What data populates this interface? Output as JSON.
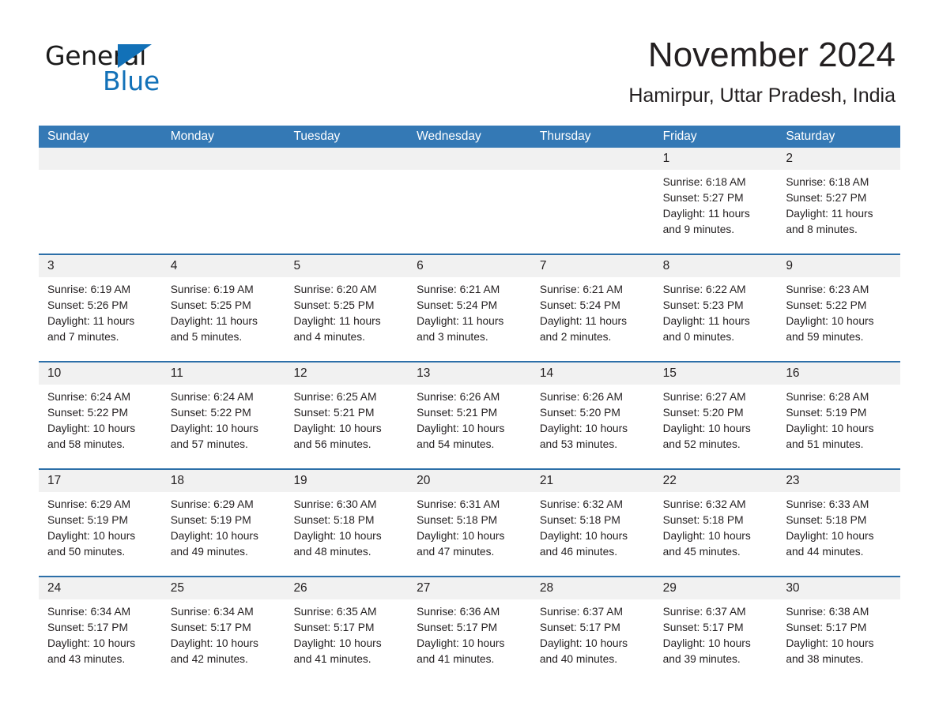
{
  "brand": {
    "name_part1": "General",
    "name_part2": "Blue",
    "triangle_icon": "triangle-icon",
    "accent_color": "#1271b8"
  },
  "header": {
    "month_title": "November 2024",
    "location": "Hamirpur, Uttar Pradesh, India"
  },
  "calendar": {
    "header_bg": "#3479b5",
    "day_band_bg": "#f1f1f1",
    "row_border": "#2c6fa8",
    "weekdays": [
      "Sunday",
      "Monday",
      "Tuesday",
      "Wednesday",
      "Thursday",
      "Friday",
      "Saturday"
    ],
    "weeks": [
      [
        {
          "date": "",
          "lines": []
        },
        {
          "date": "",
          "lines": []
        },
        {
          "date": "",
          "lines": []
        },
        {
          "date": "",
          "lines": []
        },
        {
          "date": "",
          "lines": []
        },
        {
          "date": "1",
          "lines": [
            "Sunrise: 6:18 AM",
            "Sunset: 5:27 PM",
            "Daylight: 11 hours",
            "and 9 minutes."
          ]
        },
        {
          "date": "2",
          "lines": [
            "Sunrise: 6:18 AM",
            "Sunset: 5:27 PM",
            "Daylight: 11 hours",
            "and 8 minutes."
          ]
        }
      ],
      [
        {
          "date": "3",
          "lines": [
            "Sunrise: 6:19 AM",
            "Sunset: 5:26 PM",
            "Daylight: 11 hours",
            "and 7 minutes."
          ]
        },
        {
          "date": "4",
          "lines": [
            "Sunrise: 6:19 AM",
            "Sunset: 5:25 PM",
            "Daylight: 11 hours",
            "and 5 minutes."
          ]
        },
        {
          "date": "5",
          "lines": [
            "Sunrise: 6:20 AM",
            "Sunset: 5:25 PM",
            "Daylight: 11 hours",
            "and 4 minutes."
          ]
        },
        {
          "date": "6",
          "lines": [
            "Sunrise: 6:21 AM",
            "Sunset: 5:24 PM",
            "Daylight: 11 hours",
            "and 3 minutes."
          ]
        },
        {
          "date": "7",
          "lines": [
            "Sunrise: 6:21 AM",
            "Sunset: 5:24 PM",
            "Daylight: 11 hours",
            "and 2 minutes."
          ]
        },
        {
          "date": "8",
          "lines": [
            "Sunrise: 6:22 AM",
            "Sunset: 5:23 PM",
            "Daylight: 11 hours",
            "and 0 minutes."
          ]
        },
        {
          "date": "9",
          "lines": [
            "Sunrise: 6:23 AM",
            "Sunset: 5:22 PM",
            "Daylight: 10 hours",
            "and 59 minutes."
          ]
        }
      ],
      [
        {
          "date": "10",
          "lines": [
            "Sunrise: 6:24 AM",
            "Sunset: 5:22 PM",
            "Daylight: 10 hours",
            "and 58 minutes."
          ]
        },
        {
          "date": "11",
          "lines": [
            "Sunrise: 6:24 AM",
            "Sunset: 5:22 PM",
            "Daylight: 10 hours",
            "and 57 minutes."
          ]
        },
        {
          "date": "12",
          "lines": [
            "Sunrise: 6:25 AM",
            "Sunset: 5:21 PM",
            "Daylight: 10 hours",
            "and 56 minutes."
          ]
        },
        {
          "date": "13",
          "lines": [
            "Sunrise: 6:26 AM",
            "Sunset: 5:21 PM",
            "Daylight: 10 hours",
            "and 54 minutes."
          ]
        },
        {
          "date": "14",
          "lines": [
            "Sunrise: 6:26 AM",
            "Sunset: 5:20 PM",
            "Daylight: 10 hours",
            "and 53 minutes."
          ]
        },
        {
          "date": "15",
          "lines": [
            "Sunrise: 6:27 AM",
            "Sunset: 5:20 PM",
            "Daylight: 10 hours",
            "and 52 minutes."
          ]
        },
        {
          "date": "16",
          "lines": [
            "Sunrise: 6:28 AM",
            "Sunset: 5:19 PM",
            "Daylight: 10 hours",
            "and 51 minutes."
          ]
        }
      ],
      [
        {
          "date": "17",
          "lines": [
            "Sunrise: 6:29 AM",
            "Sunset: 5:19 PM",
            "Daylight: 10 hours",
            "and 50 minutes."
          ]
        },
        {
          "date": "18",
          "lines": [
            "Sunrise: 6:29 AM",
            "Sunset: 5:19 PM",
            "Daylight: 10 hours",
            "and 49 minutes."
          ]
        },
        {
          "date": "19",
          "lines": [
            "Sunrise: 6:30 AM",
            "Sunset: 5:18 PM",
            "Daylight: 10 hours",
            "and 48 minutes."
          ]
        },
        {
          "date": "20",
          "lines": [
            "Sunrise: 6:31 AM",
            "Sunset: 5:18 PM",
            "Daylight: 10 hours",
            "and 47 minutes."
          ]
        },
        {
          "date": "21",
          "lines": [
            "Sunrise: 6:32 AM",
            "Sunset: 5:18 PM",
            "Daylight: 10 hours",
            "and 46 minutes."
          ]
        },
        {
          "date": "22",
          "lines": [
            "Sunrise: 6:32 AM",
            "Sunset: 5:18 PM",
            "Daylight: 10 hours",
            "and 45 minutes."
          ]
        },
        {
          "date": "23",
          "lines": [
            "Sunrise: 6:33 AM",
            "Sunset: 5:18 PM",
            "Daylight: 10 hours",
            "and 44 minutes."
          ]
        }
      ],
      [
        {
          "date": "24",
          "lines": [
            "Sunrise: 6:34 AM",
            "Sunset: 5:17 PM",
            "Daylight: 10 hours",
            "and 43 minutes."
          ]
        },
        {
          "date": "25",
          "lines": [
            "Sunrise: 6:34 AM",
            "Sunset: 5:17 PM",
            "Daylight: 10 hours",
            "and 42 minutes."
          ]
        },
        {
          "date": "26",
          "lines": [
            "Sunrise: 6:35 AM",
            "Sunset: 5:17 PM",
            "Daylight: 10 hours",
            "and 41 minutes."
          ]
        },
        {
          "date": "27",
          "lines": [
            "Sunrise: 6:36 AM",
            "Sunset: 5:17 PM",
            "Daylight: 10 hours",
            "and 41 minutes."
          ]
        },
        {
          "date": "28",
          "lines": [
            "Sunrise: 6:37 AM",
            "Sunset: 5:17 PM",
            "Daylight: 10 hours",
            "and 40 minutes."
          ]
        },
        {
          "date": "29",
          "lines": [
            "Sunrise: 6:37 AM",
            "Sunset: 5:17 PM",
            "Daylight: 10 hours",
            "and 39 minutes."
          ]
        },
        {
          "date": "30",
          "lines": [
            "Sunrise: 6:38 AM",
            "Sunset: 5:17 PM",
            "Daylight: 10 hours",
            "and 38 minutes."
          ]
        }
      ]
    ]
  }
}
